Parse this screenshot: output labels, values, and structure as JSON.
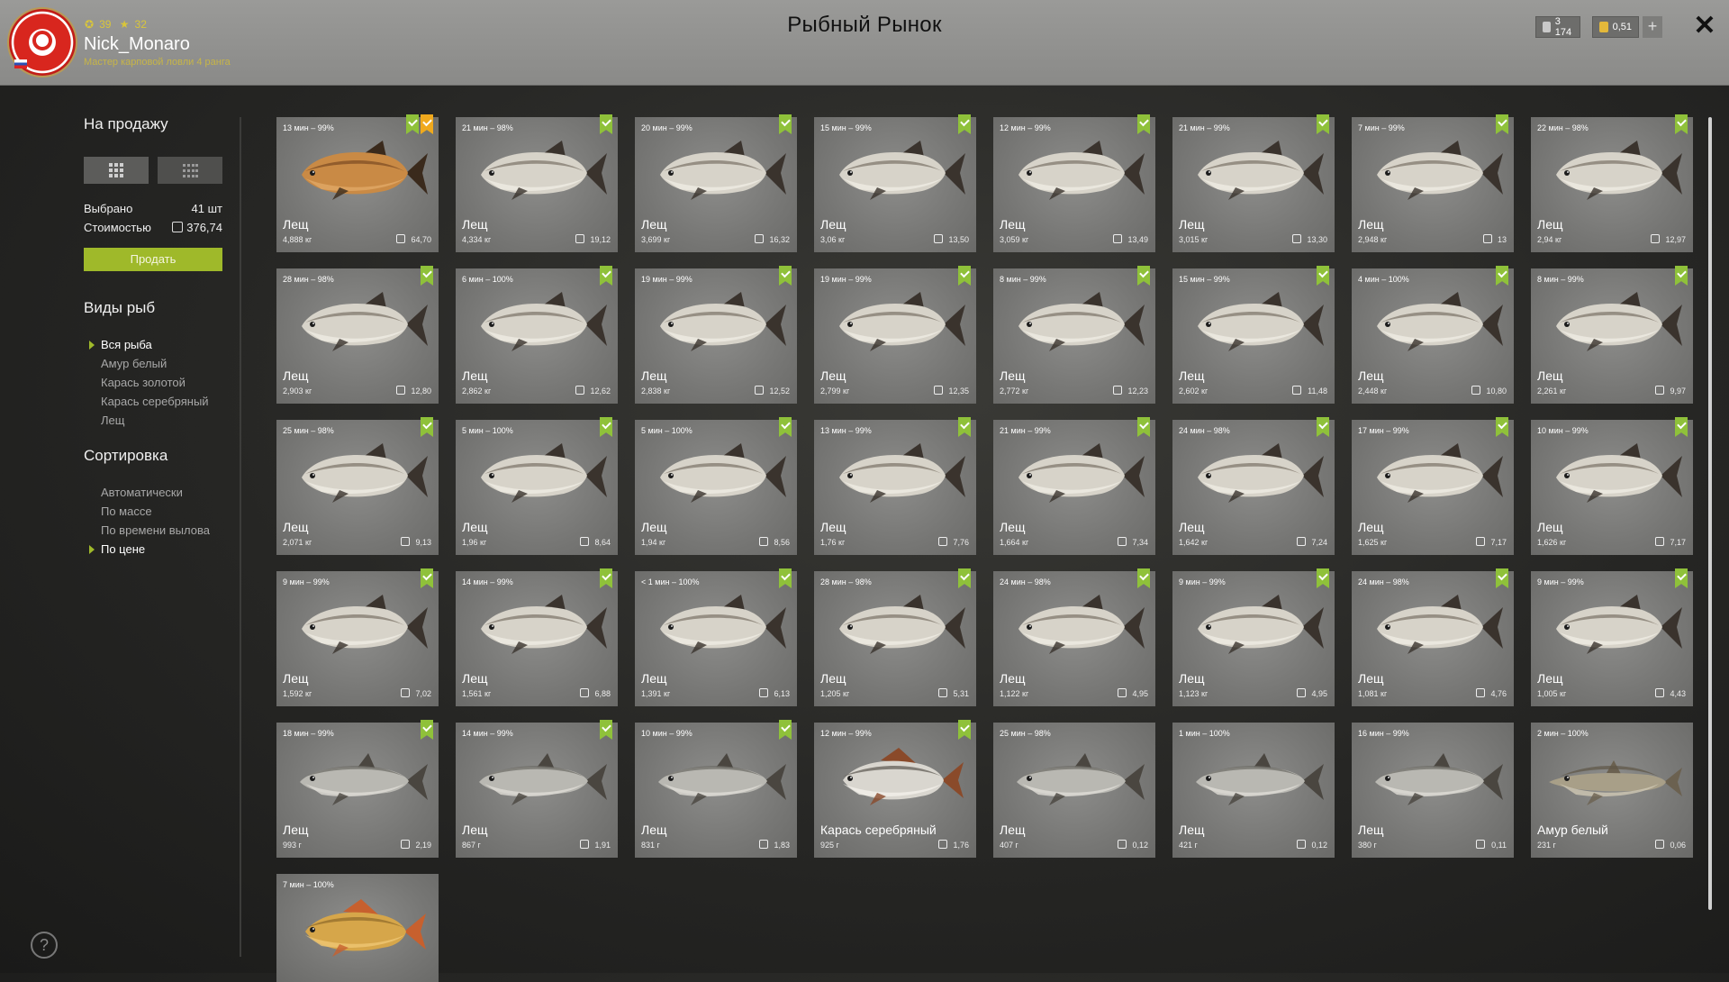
{
  "header": {
    "title": "Рыбный Рынок",
    "username": "Nick_Monaro",
    "rank": "Мастер карповой ловли 4 ранга",
    "level": "39",
    "stars": "32",
    "silver": "3 174",
    "gold": "0,51",
    "plus_label": "+",
    "close_label": "✕"
  },
  "sidebar": {
    "for_sale_title": "На продажу",
    "selected_label": "Выбрано",
    "selected_value": "41 шт",
    "cost_label": "Стоимостью",
    "cost_value": "376,74",
    "sell_button": "Продать",
    "species_title": "Виды рыб",
    "species": [
      "Вся рыба",
      "Амур белый",
      "Карась золотой",
      "Карась серебряный",
      "Лещ"
    ],
    "species_selected": 0,
    "sort_title": "Сортировка",
    "sort_options": [
      "Автоматически",
      "По массе",
      "По времени вылова",
      "По цене"
    ],
    "sort_selected": 3,
    "help_label": "?"
  },
  "colors": {
    "accent": "#9fb92a",
    "flag_green": "#8fc13a",
    "flag_gold": "#f0a91d"
  },
  "fish": [
    {
      "time": "13 мин – 99%",
      "name": "Лещ",
      "weight": "4,888 кг",
      "price": "64,70",
      "kind": "bream-gold",
      "flags": [
        "gold-star"
      ]
    },
    {
      "time": "21 мин – 98%",
      "name": "Лещ",
      "weight": "4,334 кг",
      "price": "19,12",
      "kind": "bream",
      "flags": []
    },
    {
      "time": "20 мин – 99%",
      "name": "Лещ",
      "weight": "3,699 кг",
      "price": "16,32",
      "kind": "bream",
      "flags": []
    },
    {
      "time": "15 мин – 99%",
      "name": "Лещ",
      "weight": "3,06 кг",
      "price": "13,50",
      "kind": "bream",
      "flags": []
    },
    {
      "time": "12 мин – 99%",
      "name": "Лещ",
      "weight": "3,059 кг",
      "price": "13,49",
      "kind": "bream",
      "flags": []
    },
    {
      "time": "21 мин – 99%",
      "name": "Лещ",
      "weight": "3,015 кг",
      "price": "13,30",
      "kind": "bream",
      "flags": []
    },
    {
      "time": "7 мин – 99%",
      "name": "Лещ",
      "weight": "2,948 кг",
      "price": "13",
      "kind": "bream",
      "flags": []
    },
    {
      "time": "22 мин – 98%",
      "name": "Лещ",
      "weight": "2,94 кг",
      "price": "12,97",
      "kind": "bream",
      "flags": []
    },
    {
      "time": "28 мин – 98%",
      "name": "Лещ",
      "weight": "2,903 кг",
      "price": "12,80",
      "kind": "bream",
      "flags": []
    },
    {
      "time": "6 мин – 100%",
      "name": "Лещ",
      "weight": "2,862 кг",
      "price": "12,62",
      "kind": "bream",
      "flags": []
    },
    {
      "time": "19 мин – 99%",
      "name": "Лещ",
      "weight": "2,838 кг",
      "price": "12,52",
      "kind": "bream",
      "flags": []
    },
    {
      "time": "19 мин – 99%",
      "name": "Лещ",
      "weight": "2,799 кг",
      "price": "12,35",
      "kind": "bream",
      "flags": []
    },
    {
      "time": "8 мин – 99%",
      "name": "Лещ",
      "weight": "2,772 кг",
      "price": "12,23",
      "kind": "bream",
      "flags": []
    },
    {
      "time": "15 мин – 99%",
      "name": "Лещ",
      "weight": "2,602 кг",
      "price": "11,48",
      "kind": "bream",
      "flags": []
    },
    {
      "time": "4 мин – 100%",
      "name": "Лещ",
      "weight": "2,448 кг",
      "price": "10,80",
      "kind": "bream",
      "flags": []
    },
    {
      "time": "8 мин – 99%",
      "name": "Лещ",
      "weight": "2,261 кг",
      "price": "9,97",
      "kind": "bream",
      "flags": []
    },
    {
      "time": "25 мин – 98%",
      "name": "Лещ",
      "weight": "2,071 кг",
      "price": "9,13",
      "kind": "bream",
      "flags": []
    },
    {
      "time": "5 мин – 100%",
      "name": "Лещ",
      "weight": "1,96 кг",
      "price": "8,64",
      "kind": "bream",
      "flags": []
    },
    {
      "time": "5 мин – 100%",
      "name": "Лещ",
      "weight": "1,94 кг",
      "price": "8,56",
      "kind": "bream",
      "flags": []
    },
    {
      "time": "13 мин – 99%",
      "name": "Лещ",
      "weight": "1,76 кг",
      "price": "7,76",
      "kind": "bream",
      "flags": []
    },
    {
      "time": "21 мин – 99%",
      "name": "Лещ",
      "weight": "1,664 кг",
      "price": "7,34",
      "kind": "bream",
      "flags": []
    },
    {
      "time": "24 мин – 98%",
      "name": "Лещ",
      "weight": "1,642 кг",
      "price": "7,24",
      "kind": "bream",
      "flags": []
    },
    {
      "time": "17 мин – 99%",
      "name": "Лещ",
      "weight": "1,625 кг",
      "price": "7,17",
      "kind": "bream",
      "flags": []
    },
    {
      "time": "10 мин – 99%",
      "name": "Лещ",
      "weight": "1,626 кг",
      "price": "7,17",
      "kind": "bream",
      "flags": []
    },
    {
      "time": "9 мин – 99%",
      "name": "Лещ",
      "weight": "1,592 кг",
      "price": "7,02",
      "kind": "bream",
      "flags": []
    },
    {
      "time": "14 мин – 99%",
      "name": "Лещ",
      "weight": "1,561 кг",
      "price": "6,88",
      "kind": "bream",
      "flags": []
    },
    {
      "time": "< 1 мин – 100%",
      "name": "Лещ",
      "weight": "1,391 кг",
      "price": "6,13",
      "kind": "bream",
      "flags": []
    },
    {
      "time": "28 мин – 98%",
      "name": "Лещ",
      "weight": "1,205 кг",
      "price": "5,31",
      "kind": "bream",
      "flags": []
    },
    {
      "time": "24 мин – 98%",
      "name": "Лещ",
      "weight": "1,122 кг",
      "price": "4,95",
      "kind": "bream",
      "flags": []
    },
    {
      "time": "9 мин – 99%",
      "name": "Лещ",
      "weight": "1,123 кг",
      "price": "4,95",
      "kind": "bream",
      "flags": []
    },
    {
      "time": "24 мин – 98%",
      "name": "Лещ",
      "weight": "1,081 кг",
      "price": "4,76",
      "kind": "bream",
      "flags": []
    },
    {
      "time": "9 мин – 99%",
      "name": "Лещ",
      "weight": "1,005 кг",
      "price": "4,43",
      "kind": "bream",
      "flags": []
    },
    {
      "time": "18 мин – 99%",
      "name": "Лещ",
      "weight": "993 г",
      "price": "2,19",
      "kind": "small",
      "flags": []
    },
    {
      "time": "14 мин – 99%",
      "name": "Лещ",
      "weight": "867 г",
      "price": "1,91",
      "kind": "small",
      "flags": []
    },
    {
      "time": "10 мин – 99%",
      "name": "Лещ",
      "weight": "831 г",
      "price": "1,83",
      "kind": "small",
      "flags": []
    },
    {
      "time": "12 мин – 99%",
      "name": "Карась серебряный",
      "weight": "925 г",
      "price": "1,76",
      "kind": "carp-silver",
      "flags": []
    },
    {
      "time": "25 мин – 98%",
      "name": "Лещ",
      "weight": "407 г",
      "price": "0,12",
      "kind": "small",
      "flags": [],
      "noflag": true
    },
    {
      "time": "1 мин – 100%",
      "name": "Лещ",
      "weight": "421 г",
      "price": "0,12",
      "kind": "small",
      "flags": [],
      "noflag": true
    },
    {
      "time": "16 мин – 99%",
      "name": "Лещ",
      "weight": "380 г",
      "price": "0,11",
      "kind": "small",
      "flags": [],
      "noflag": true
    },
    {
      "time": "2 мин – 100%",
      "name": "Амур белый",
      "weight": "231 г",
      "price": "0,06",
      "kind": "amur",
      "flags": [],
      "noflag": true
    },
    {
      "time": "7 мин – 100%",
      "name": "",
      "weight": "",
      "price": "",
      "kind": "carp-gold",
      "flags": [],
      "noflag": true,
      "partial": true
    }
  ]
}
